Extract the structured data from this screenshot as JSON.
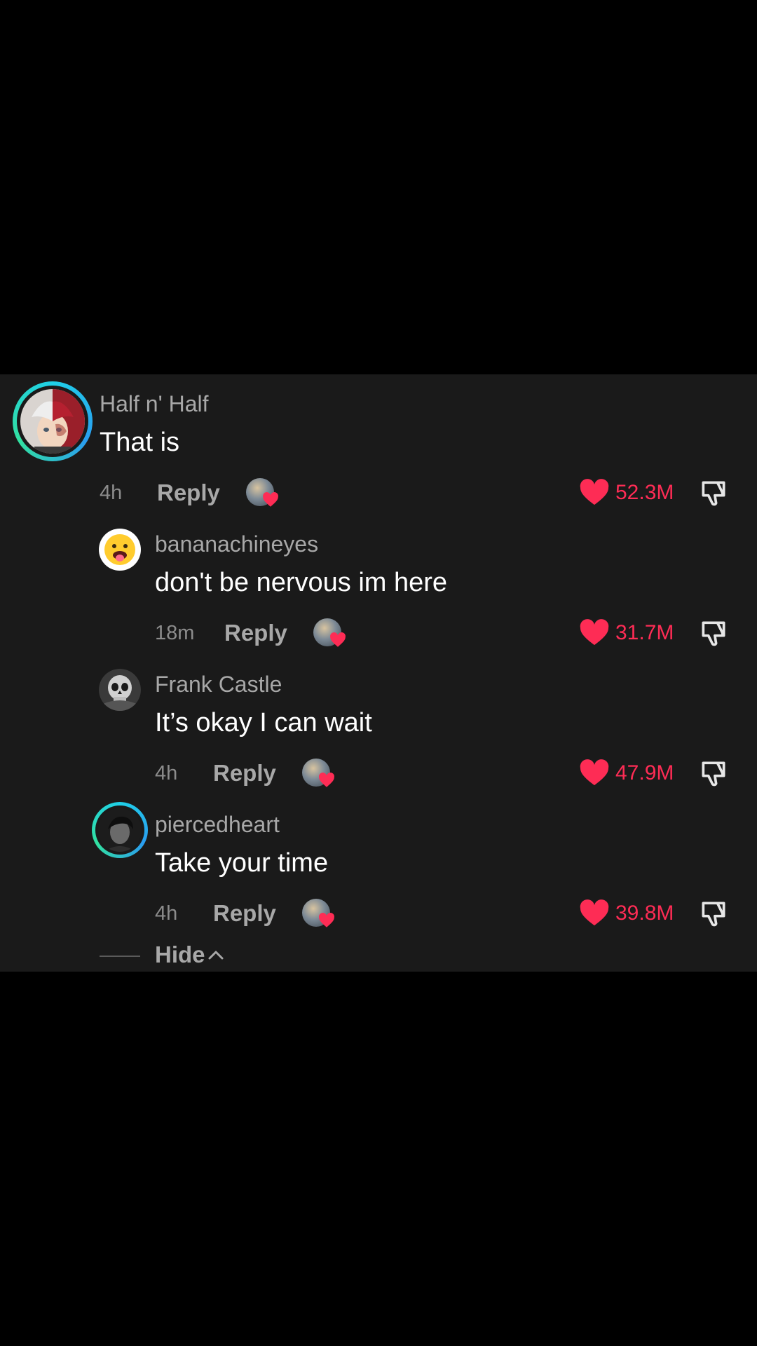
{
  "comments": [
    {
      "username": "Half n' Half",
      "text": "That is",
      "time": "4h",
      "reply_label": "Reply",
      "likes": "52.3M",
      "avatar_icon": "anime-avatar-icon"
    },
    {
      "username": "bananachineyes",
      "text": "don't be nervous im here",
      "time": "18m",
      "reply_label": "Reply",
      "likes": "31.7M",
      "avatar_icon": "tongue-face-icon"
    },
    {
      "username": "Frank Castle",
      "text": "It’s okay I can wait",
      "time": "4h",
      "reply_label": "Reply",
      "likes": "47.9M",
      "avatar_icon": "skull-avatar-icon"
    },
    {
      "username": "piercedheart",
      "text": "Take your time",
      "time": "4h",
      "reply_label": "Reply",
      "likes": "39.8M",
      "avatar_icon": "dark-portrait-avatar-icon"
    }
  ],
  "hide_label": "Hide",
  "colors": {
    "background": "#000000",
    "panel": "#1a1a1a",
    "like": "#fe2c55",
    "ring": "#1fd0e8"
  }
}
